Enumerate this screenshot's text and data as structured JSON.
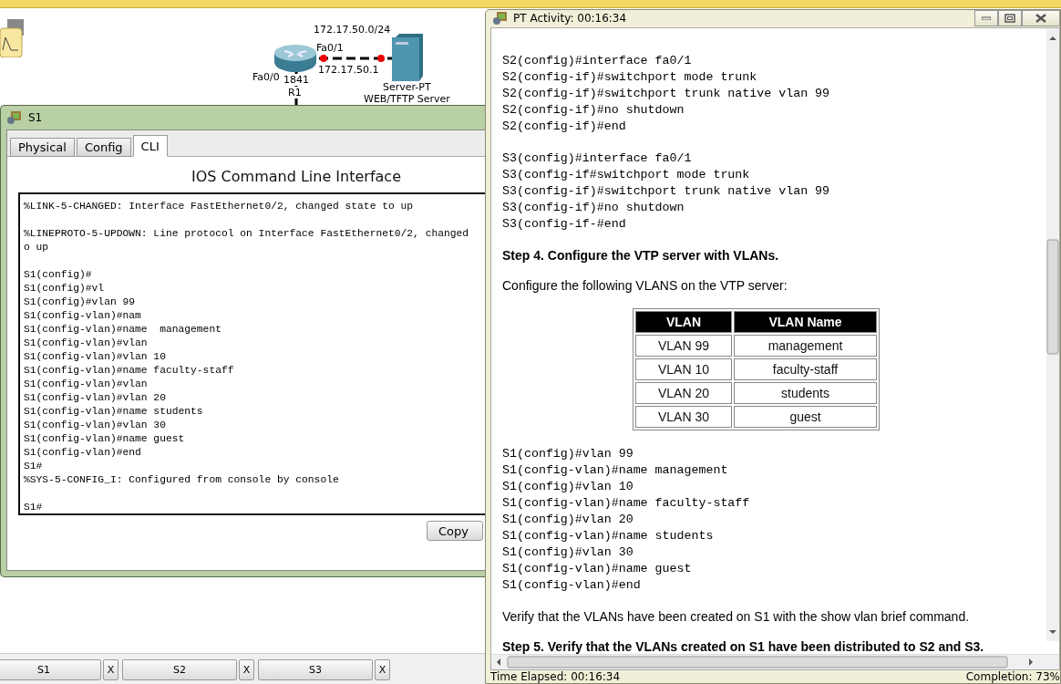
{
  "topology": {
    "network": "172.17.50.0/24",
    "router": {
      "model": "1841",
      "name": "R1",
      "ports": [
        "Fa0/0",
        "Fa0/1"
      ],
      "address": "172.17.50.1"
    },
    "server": {
      "type": "Server-PT",
      "name": "WEB/TFTP Server"
    }
  },
  "cli_window": {
    "title": "S1",
    "tabs": [
      {
        "label": "Physical",
        "selected": false
      },
      {
        "label": "Config",
        "selected": false
      },
      {
        "label": "CLI",
        "selected": true
      }
    ],
    "heading": "IOS Command Line Interface",
    "console_blocks": [
      [
        "%LINK-5-CHANGED: Interface FastEthernet0/2, changed state to up"
      ],
      [
        "%LINEPROTO-5-UPDOWN: Line protocol on Interface FastEthernet0/2, changed",
        "o up"
      ],
      [
        "S1(config)#",
        "S1(config)#vl",
        "S1(config)#vlan 99",
        "S1(config-vlan)#nam",
        "S1(config-vlan)#name  management",
        "S1(config-vlan)#vlan",
        "S1(config-vlan)#vlan 10",
        "S1(config-vlan)#name faculty-staff",
        "S1(config-vlan)#vlan",
        "S1(config-vlan)#vlan 20",
        "S1(config-vlan)#name students",
        "S1(config-vlan)#vlan 30",
        "S1(config-vlan)#name guest",
        "S1(config-vlan)#end",
        "S1#",
        "%SYS-5-CONFIG_I: Configured from console by console"
      ],
      [
        "S1#"
      ]
    ],
    "copy_button": "Copy"
  },
  "taskbar": [
    {
      "label": "S1",
      "close": "X"
    },
    {
      "label": "S2",
      "close": "X"
    },
    {
      "label": "S3",
      "close": "X"
    }
  ],
  "activity_window": {
    "title": "PT Activity: 00:16:34",
    "blocks": [
      {
        "kind": "code",
        "lines": [
          "S2(config)#interface fa0/1",
          "S2(config-if)#switchport mode trunk",
          "S2(config-if)#switchport trunk native vlan 99",
          "S2(config-if)#no shutdown",
          "S2(config-if)#end"
        ]
      },
      {
        "kind": "code",
        "lines": [
          "S3(config)#interface fa0/1",
          "S3(config-if#switchport mode trunk",
          "S3(config-if)#switchport trunk native vlan 99",
          "S3(config-if)#no shutdown",
          "S3(config-if-#end"
        ]
      },
      {
        "kind": "heading",
        "text": "Step 4. Configure the VTP server with VLANs."
      },
      {
        "kind": "text",
        "text": "Configure the following VLANS on the VTP server:"
      },
      {
        "kind": "table",
        "columns": [
          "VLAN",
          "VLAN Name"
        ],
        "rows": [
          [
            "VLAN 99",
            "management"
          ],
          [
            "VLAN 10",
            "faculty-staff"
          ],
          [
            "VLAN 20",
            "students"
          ],
          [
            "VLAN 30",
            "guest"
          ]
        ]
      },
      {
        "kind": "code",
        "lines": [
          "S1(config)#vlan 99",
          "S1(config-vlan)#name management",
          "S1(config)#vlan 10",
          "S1(config-vlan)#name faculty-staff",
          "S1(config)#vlan 20",
          "S1(config-vlan)#name students",
          "S1(config)#vlan 30",
          "S1(config-vlan)#name guest",
          "S1(config-vlan)#end"
        ]
      },
      {
        "kind": "text",
        "text": "Verify that the VLANs have been created on S1 with the show vlan brief command."
      },
      {
        "kind": "heading",
        "text": "Step 5. Verify that the VLANs created on S1 have been distributed to S2 and S3."
      }
    ],
    "time_elapsed": "Time Elapsed: 00:16:34",
    "completion": "Completion: 73%"
  }
}
